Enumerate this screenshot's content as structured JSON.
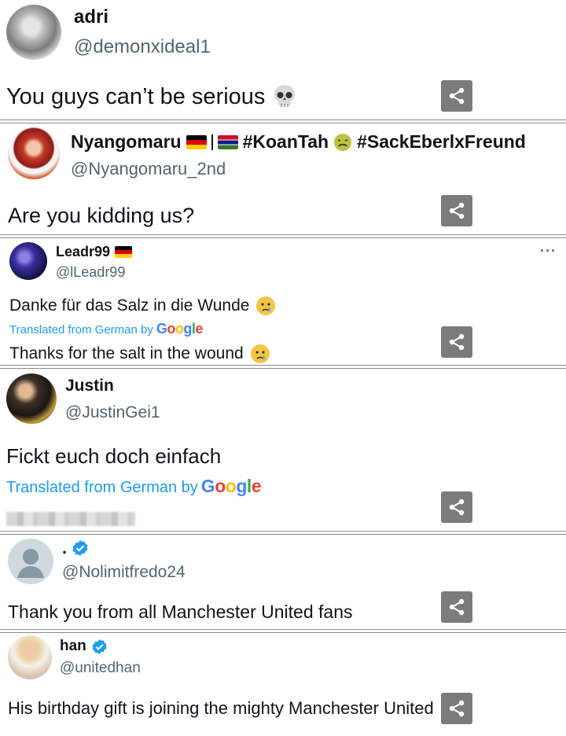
{
  "posts": [
    {
      "name": "adri",
      "handle": "@demonxideal1",
      "text": "You guys can’t be serious",
      "emoji": "skull"
    },
    {
      "name": "Nyangomaru",
      "name_suffix": "#KoanTah",
      "name_suffix2": "#SackEberlxFreund",
      "handle": "@Nyangomaru_2nd",
      "text": "Are you kidding us?"
    },
    {
      "name": "Leadr99",
      "handle": "@lLeadr99",
      "more": "···",
      "text": "Danke für das Salz in die Wunde",
      "translated_label": "Translated from German by",
      "translation": "Thanks for the salt in the wound"
    },
    {
      "name": "Justin",
      "handle": "@JustinGei1",
      "text": "Fickt euch doch einfach",
      "translated_label": "Translated from German by"
    },
    {
      "name": ".",
      "handle": "@Nolimitfredo24",
      "text": "Thank you from all Manchester United fans"
    },
    {
      "name": "han",
      "handle": "@unitedhan",
      "text": "His birthday gift is joining the mighty Manchester United"
    }
  ],
  "google": {
    "G": "G",
    "o1": "o",
    "o2": "o",
    "g": "g",
    "l": "l",
    "e": "e"
  },
  "colors": {
    "link": "#1d9bf0",
    "handle": "#536471",
    "verified": "#1d9bf0",
    "share_bg": "#7b7b7b"
  }
}
